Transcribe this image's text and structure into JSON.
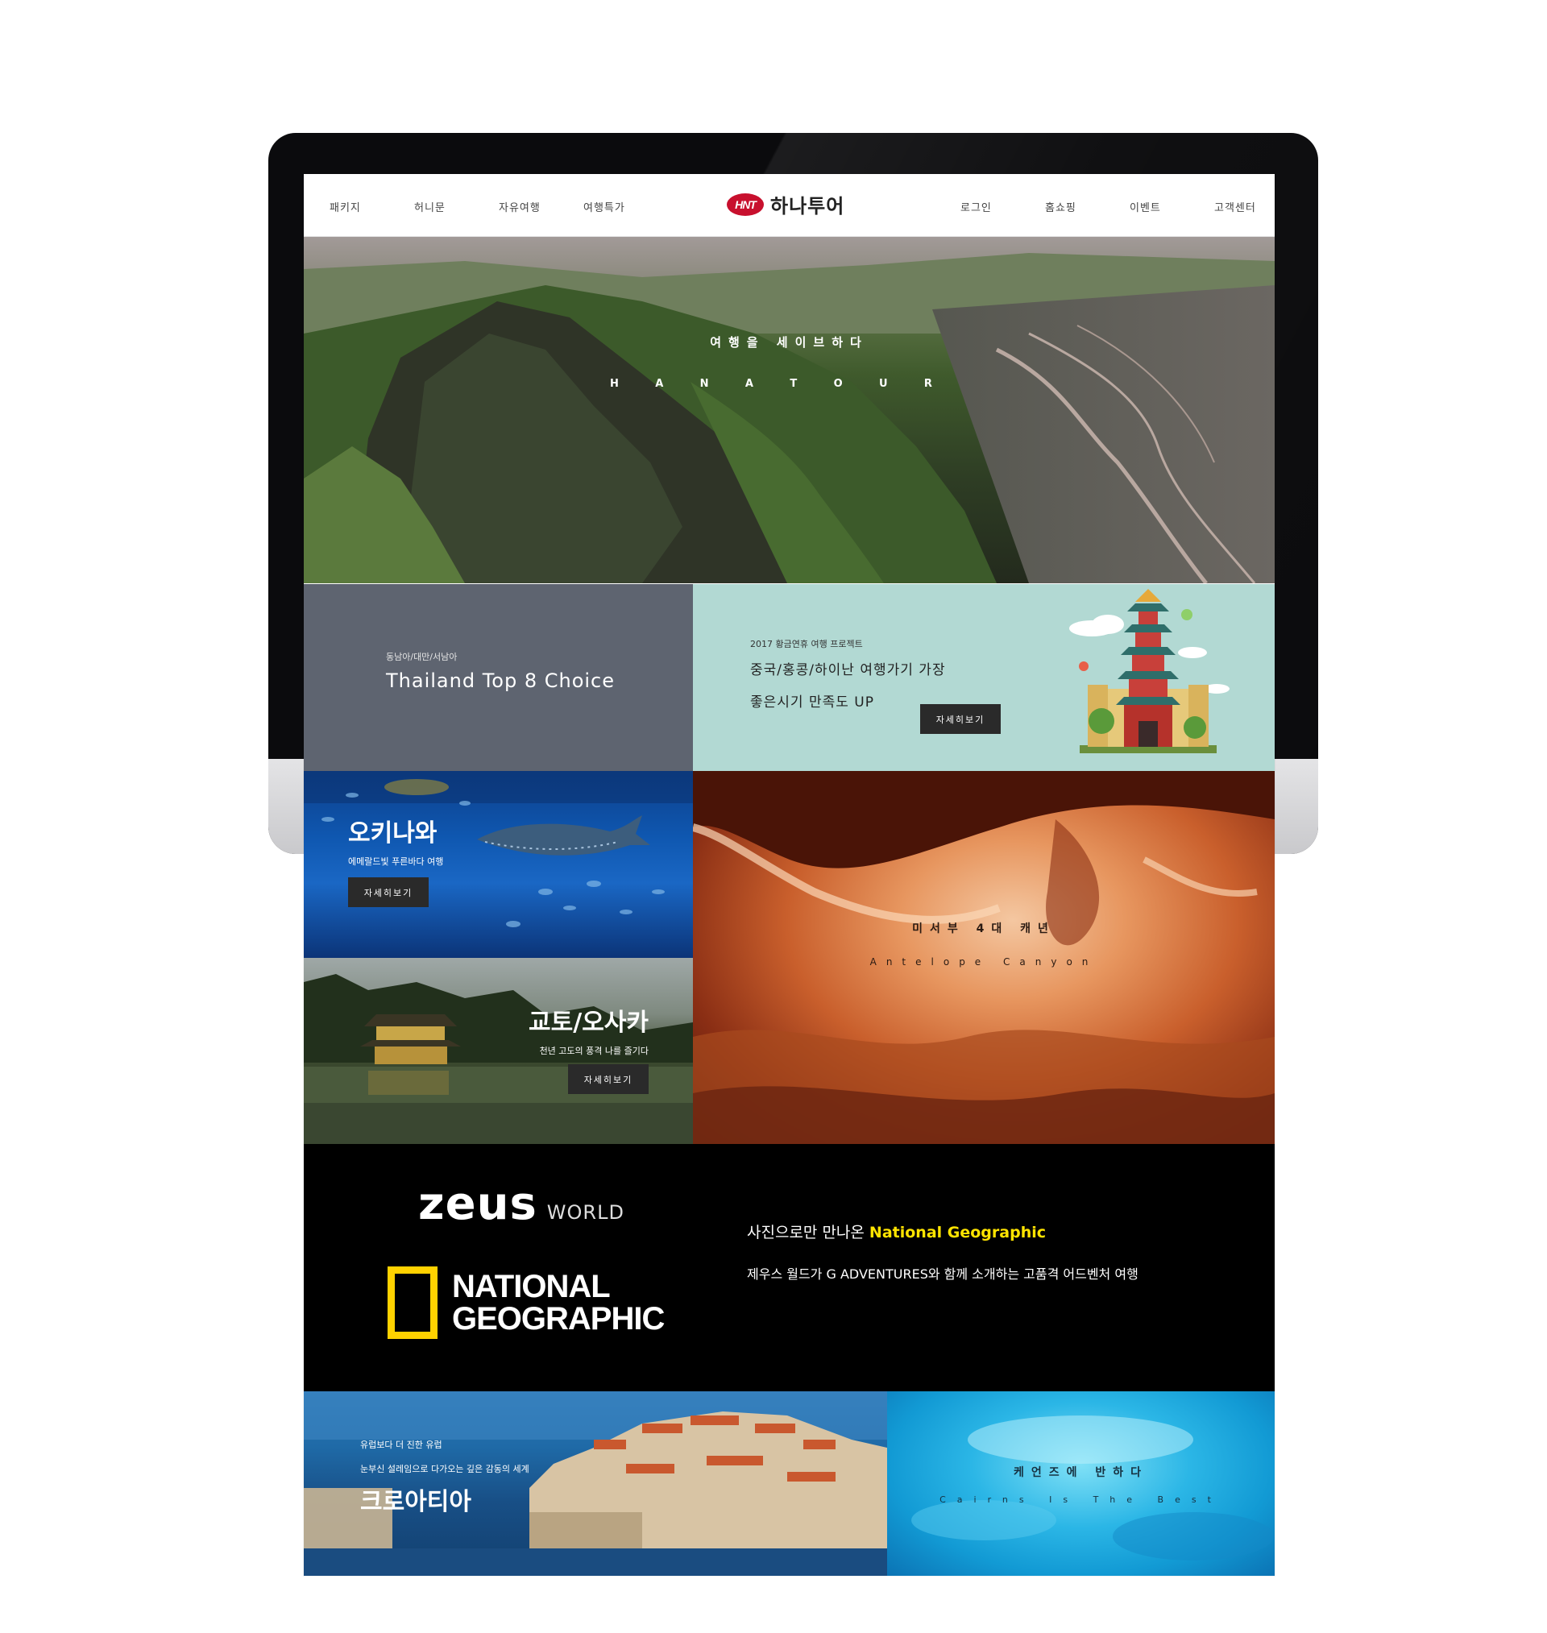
{
  "header": {
    "nav_left": [
      "패키지",
      "허니문",
      "자유여행",
      "여행특가"
    ],
    "nav_right": [
      "로그인",
      "홈쇼핑",
      "이벤트",
      "고객센터"
    ],
    "logo_badge": "HNT",
    "logo_text": "하나투어"
  },
  "hero": {
    "title": "여행을 세이브하다",
    "letters": [
      "H",
      "A",
      "N",
      "A",
      "T",
      "O",
      "U",
      "R"
    ]
  },
  "promo_thailand": {
    "kicker": "동남아/대만/서남아",
    "title": "Thailand Top 8 Choice"
  },
  "promo_china": {
    "kicker": "2017 황금연휴 여행 프로젝트",
    "line1": "중국/홍콩/하이난 여행가기 가장",
    "line2": "좋은시기 만족도 UP",
    "button": "자세히보기"
  },
  "okinawa": {
    "title": "오키나와",
    "sub": "에메랄드빛 푸른바다 여행",
    "button": "자세히보기"
  },
  "kyoto": {
    "title": "교토/오사카",
    "sub": "천년 고도의 풍격 나를 즐기다",
    "button": "자세히보기"
  },
  "canyon": {
    "title": "미서부 4대 캐년",
    "sub": "Antelope Canyon"
  },
  "natgeo": {
    "zeus_big": "zeus",
    "zeus_small": "WORLD",
    "ng_line_a": "NATIONAL",
    "ng_line_b": "GEOGRAPHIC",
    "line1_prefix": "사진으로만 만나온 ",
    "line1_highlight": "National Geographic",
    "line2": "제우스 월드가 G ADVENTURES와 함께 소개하는 고품격 어드벤처 여행"
  },
  "croatia": {
    "k1": "유럽보다 더 진한 유럽",
    "k2": "눈부신 설레임으로 다가오는 깊은 감동의 세계",
    "title": "크로아티아"
  },
  "cairns": {
    "title": "케언즈에 반하다",
    "sub": "Cairns Is The Best"
  },
  "colors": {
    "promo_left_bg": "#5e6470",
    "promo_right_bg": "#b2d9d3",
    "natgeo_yellow": "#ffd200",
    "highlight_yellow": "#ffe400",
    "logo_red": "#c8102e"
  }
}
